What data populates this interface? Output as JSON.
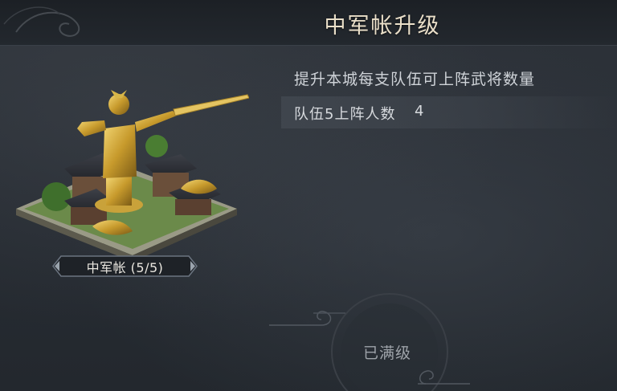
{
  "header": {
    "title": "中军帐升级"
  },
  "upgrade_info": {
    "description": "提升本城每支队伍可上阵武将数量",
    "stat_label": "队伍5上阵人数",
    "stat_value": "4"
  },
  "building": {
    "name_level": "中军帐 (5/5)",
    "image_icon": "golden-general-statue-palace"
  },
  "action": {
    "max_level_label": "已满级"
  },
  "colors": {
    "title_text": "#eadfc9",
    "accent_gold": "#d4b04a",
    "background": "#2a2f36"
  }
}
